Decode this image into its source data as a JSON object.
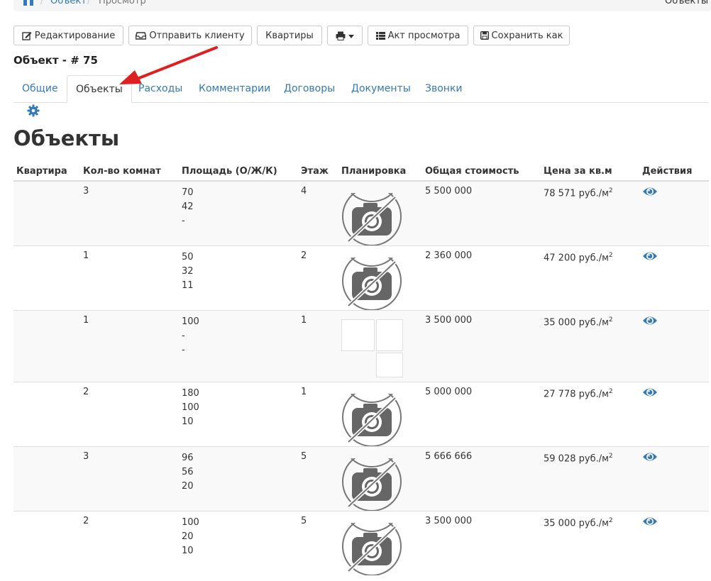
{
  "breadcrumb": {
    "link": "Объект",
    "current": "Просмотр",
    "right": "Объекты"
  },
  "toolbar": {
    "edit": "Редактирование",
    "send": "Отправить клиенту",
    "apartments": "Квартиры",
    "act": "Акт просмотра",
    "save_as": "Сохранить как"
  },
  "object_title": "Объект - # 75",
  "tabs": [
    {
      "label": "Общие",
      "active": false
    },
    {
      "label": "Объекты",
      "active": true
    },
    {
      "label": "Расходы",
      "active": false
    },
    {
      "label": "Комментарии",
      "active": false
    },
    {
      "label": "Договоры",
      "active": false
    },
    {
      "label": "Документы",
      "active": false
    },
    {
      "label": "Звонки",
      "active": false
    }
  ],
  "heading": "Объекты",
  "table": {
    "headers": [
      "Квартира",
      "Кол-во комнат",
      "Площадь (О/Ж/К)",
      "Этаж",
      "Планировка",
      "Общая стоимость",
      "Цена за кв.м",
      "Действия"
    ],
    "rows": [
      {
        "apartment": "",
        "rooms": "3",
        "area": [
          "70",
          "42",
          "-"
        ],
        "floor": "4",
        "plan": "no-photo",
        "total": "5 500 000",
        "price": "78 571 руб./м",
        "price_sup": "2"
      },
      {
        "apartment": "",
        "rooms": "1",
        "area": [
          "50",
          "32",
          "11"
        ],
        "floor": "2",
        "plan": "no-photo",
        "total": "2 360 000",
        "price": "47 200 руб./м",
        "price_sup": "2"
      },
      {
        "apartment": "",
        "rooms": "1",
        "area": [
          "100",
          "-",
          "-"
        ],
        "floor": "1",
        "plan": "image-frames",
        "total": "3 500 000",
        "price": "35 000 руб./м",
        "price_sup": "2"
      },
      {
        "apartment": "",
        "rooms": "2",
        "area": [
          "180",
          "100",
          "10"
        ],
        "floor": "1",
        "plan": "no-photo",
        "total": "5 000 000",
        "price": "27 778 руб./м",
        "price_sup": "2"
      },
      {
        "apartment": "",
        "rooms": "3",
        "area": [
          "96",
          "56",
          "20"
        ],
        "floor": "5",
        "plan": "no-photo",
        "total": "5 666 666",
        "price": "59 028 руб./м",
        "price_sup": "2"
      },
      {
        "apartment": "",
        "rooms": "2",
        "area": [
          "100",
          "20",
          "10"
        ],
        "floor": "5",
        "plan": "no-photo",
        "total": "3 500 000",
        "price": "35 000 руб./м",
        "price_sup": "2"
      }
    ]
  },
  "colors": {
    "link": "#337ab7",
    "arrow": "#e02020",
    "icon_gray": "#666666",
    "stripe": "#f9f9f9"
  }
}
